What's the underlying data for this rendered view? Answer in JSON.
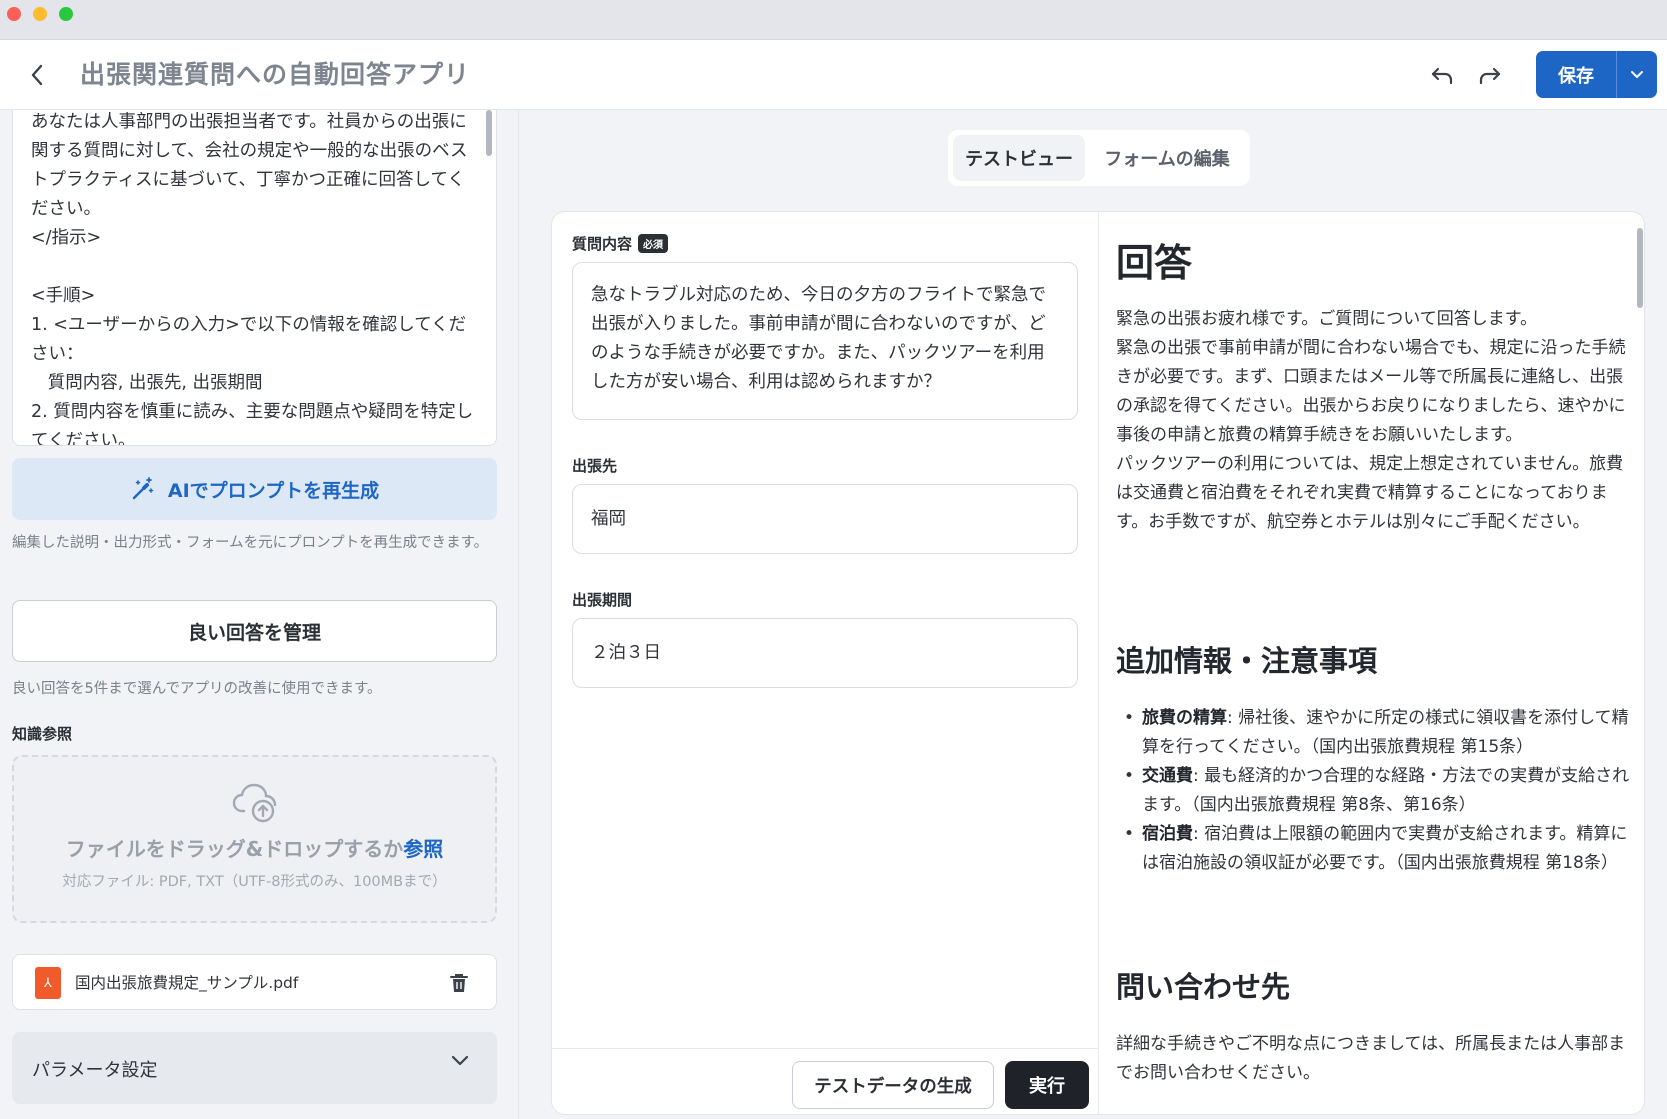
{
  "header": {
    "title": "出張関連質問への自動回答アプリ",
    "save_label": "保存",
    "accent": "#1e66c6"
  },
  "left": {
    "prompt_text": "あなたは人事部門の出張担当者です。社員からの出張に関する質問に対して、会社の規定や一般的な出張のベストプラクティスに基づいて、丁寧かつ正確に回答してください。\n</指示>\n\n<手順>\n1. <ユーザーからの入力>で以下の情報を確認してください：\n   質問内容, 出張先, 出張期間\n2. 質問内容を慎重に読み、主要な問題点や疑問を特定してください。",
    "regen_label": "AIでプロンプトを再生成",
    "regen_note": "編集した説明・出力形式・フォームを元にプロンプトを再生成できます。",
    "manage_label": "良い回答を管理",
    "manage_note": "良い回答を5件まで選んでアプリの改善に使用できます。",
    "knowledge_label": "知識参照",
    "drop_text": "ファイルをドラッグ&ドロップするか",
    "drop_link": "参照",
    "drop_formats": "対応ファイル: PDF, TXT（UTF-8形式のみ、100MBまで）",
    "file_name": "国内出張旅費規定_サンプル.pdf",
    "params_label": "パラメータ設定"
  },
  "tabs": [
    {
      "label": "テストビュー",
      "active": true
    },
    {
      "label": "フォームの編集",
      "active": false
    }
  ],
  "form": {
    "question_label": "質問内容",
    "required_badge": "必須",
    "question_value": "急なトラブル対応のため、今日の夕方のフライトで緊急で出張が入りました。事前申請が間に合わないのですが、どのような手続きが必要ですか。また、パックツアーを利用した方が安い場合、利用は認められますか？",
    "destination_label": "出張先",
    "destination_value": "福岡",
    "period_label": "出張期間",
    "period_value": "２泊３日",
    "gen_label": "テストデータの生成",
    "run_label": "実行"
  },
  "answer": {
    "heading": "回答",
    "para1": "緊急の出張お疲れ様です。ご質問について回答します。\n緊急の出張で事前申請が間に合わない場合でも、規定に沿った手続きが必要です。まず、口頭またはメール等で所属長に連絡し、出張の承認を得てください。出張からお戻りになりましたら、速やかに事後の申請と旅費の精算手続きをお願いいたします。\nパックツアーの利用については、規定上想定されていません。旅費は交通費と宿泊費をそれぞれ実費で精算することになっております。お手数ですが、航空券とホテルは別々にご手配ください。",
    "heading2": "追加情報・注意事項",
    "items": [
      {
        "term": "旅費の精算",
        "text": ": 帰社後、速やかに所定の様式に領収書を添付して精算を行ってください。（国内出張旅費規程 第15条）"
      },
      {
        "term": "交通費",
        "text": ": 最も経済的かつ合理的な経路・方法での実費が支給されます。（国内出張旅費規程 第8条、第16条）"
      },
      {
        "term": "宿泊費",
        "text": ": 宿泊費は上限額の範囲内で実費が支給されます。精算には宿泊施設の領収証が必要です。（国内出張旅費規程 第18条）"
      }
    ],
    "heading3": "問い合わせ先",
    "para2": "詳細な手続きやご不明な点につきましては、所属長または人事部までお問い合わせください。"
  }
}
